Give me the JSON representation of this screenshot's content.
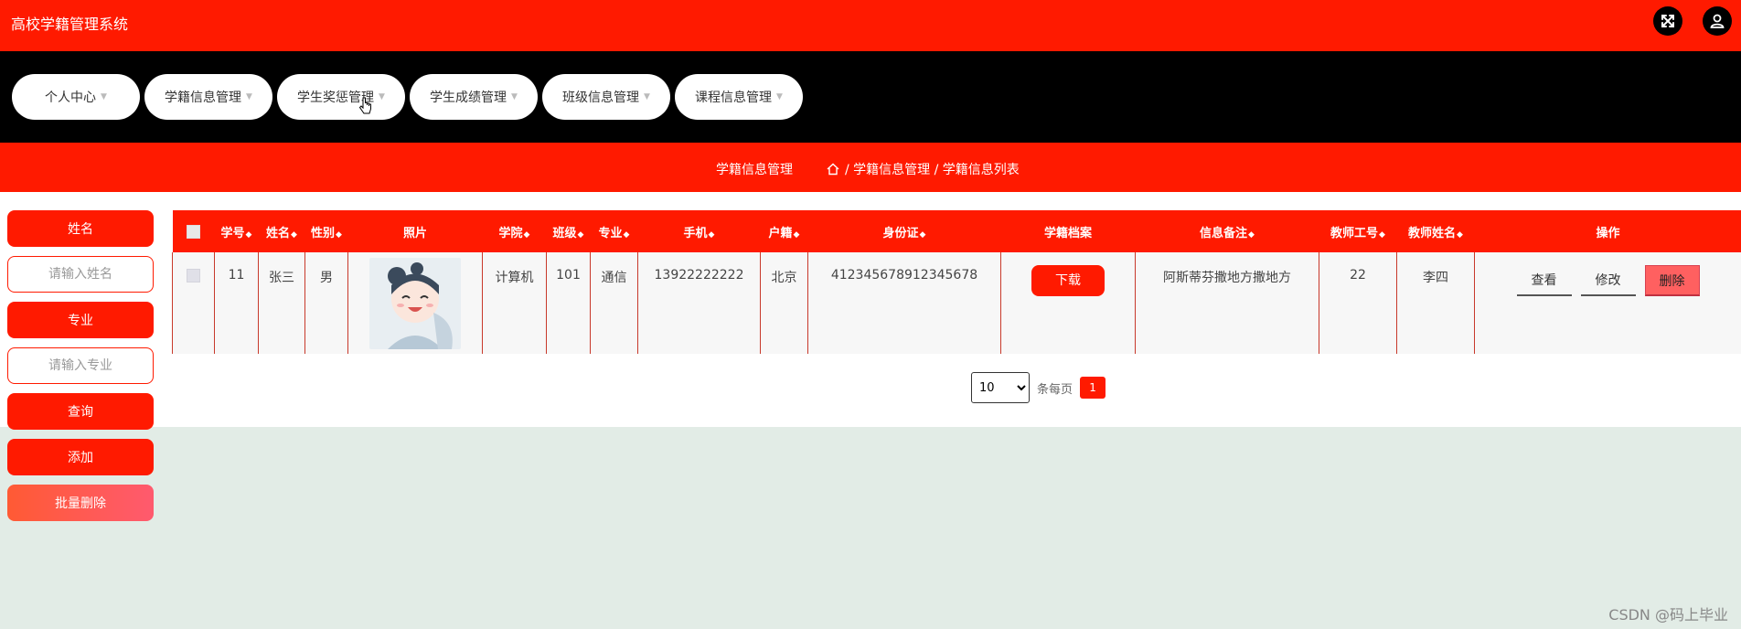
{
  "app": {
    "title": "高校学籍管理系统"
  },
  "header": {
    "fullscreen_icon": "expand-icon",
    "user_icon": "user-icon"
  },
  "nav": {
    "items": [
      {
        "label": "个人中心"
      },
      {
        "label": "学籍信息管理"
      },
      {
        "label": "学生奖惩管理"
      },
      {
        "label": "学生成绩管理"
      },
      {
        "label": "班级信息管理"
      },
      {
        "label": "课程信息管理"
      }
    ]
  },
  "breadcrumb": {
    "section": "学籍信息管理",
    "home_icon": "home-icon",
    "path": "/ 学籍信息管理 / 学籍信息列表"
  },
  "sidebar": {
    "name_label": "姓名",
    "name_placeholder": "请输入姓名",
    "major_label": "专业",
    "major_placeholder": "请输入专业",
    "search_label": "查询",
    "add_label": "添加",
    "batch_delete_label": "批量删除"
  },
  "table": {
    "columns": [
      "学号",
      "姓名",
      "性别",
      "照片",
      "学院",
      "班级",
      "专业",
      "手机",
      "户籍",
      "身份证",
      "学籍档案",
      "信息备注",
      "教师工号",
      "教师姓名",
      "操作"
    ],
    "rows": [
      {
        "id": "11",
        "name": "张三",
        "gender": "男",
        "college": "计算机",
        "class": "101",
        "major": "通信",
        "phone": "13922222222",
        "hometown": "北京",
        "id_card": "412345678912345678",
        "file_button": "下载",
        "remark": "阿斯蒂芬撒地方撒地方",
        "teacher_id": "22",
        "teacher_name": "李四",
        "view_label": "查看",
        "edit_label": "修改",
        "delete_label": "删除"
      }
    ]
  },
  "pagination": {
    "page_size": "10",
    "page_size_options": [
      "10"
    ],
    "per_page_label": "条每页",
    "current_page": "1"
  },
  "watermark": "CSDN @码上毕业",
  "colors": {
    "primary": "#ff1a00",
    "nav_bg": "#000000",
    "page_bg": "#e2ece6",
    "danger": "#ff6060"
  }
}
